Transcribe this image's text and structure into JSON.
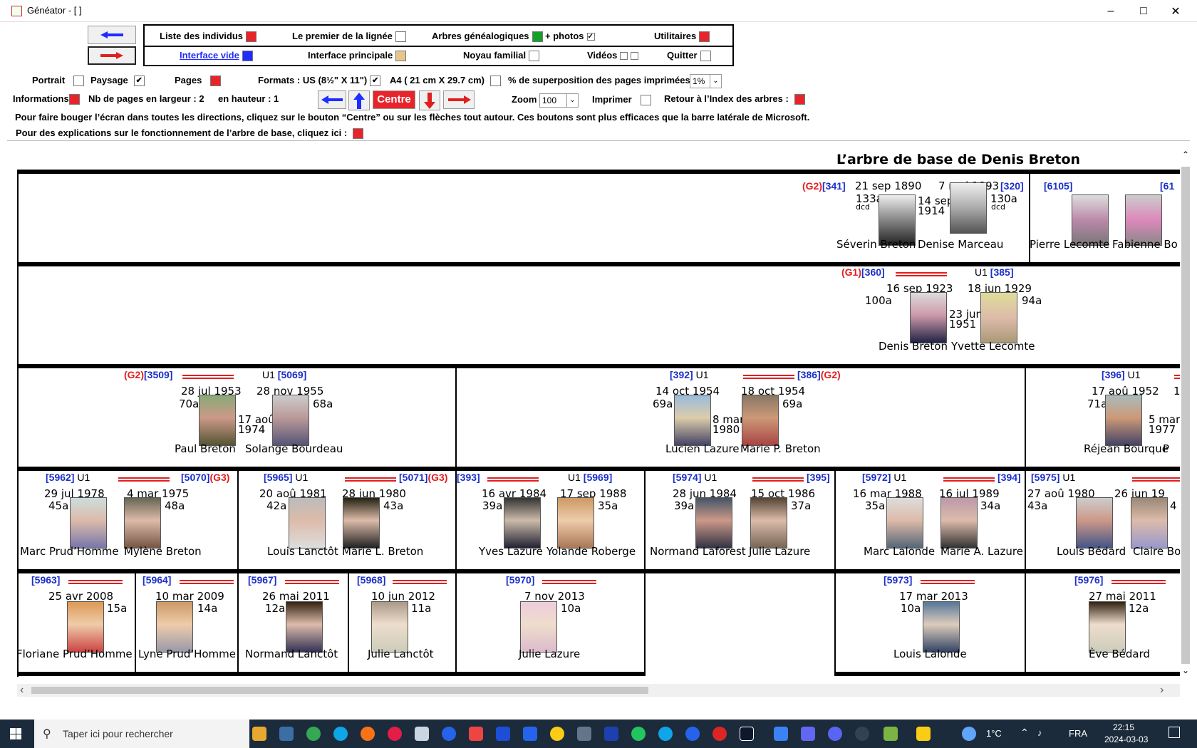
{
  "window": {
    "title": "Généator - [ ]"
  },
  "menu": {
    "row1": [
      "Liste des individus",
      "Le premier de la lignée",
      "Arbres généalogiques",
      "+ photos",
      "Utilitaires"
    ],
    "row2": [
      "Interface vide",
      "Interface principale",
      "Noyau familial",
      "Vidéos",
      "Quitter"
    ]
  },
  "controls": {
    "portrait": "Portrait",
    "paysage": "Paysage",
    "pages": "Pages",
    "formats": "Formats : US (8½\" X 11\")",
    "a4": "A4 ( 21 cm X 29.7 cm)",
    "superposition": "% de superposition des pages imprimées",
    "superposition_value": "1%",
    "informations": "Informations",
    "nb_largeur": "Nb de pages en largeur :  2",
    "hauteur": "en hauteur :  1",
    "centre": "Centre",
    "zoom": "Zoom",
    "zoom_value": "100",
    "imprimer": "Imprimer",
    "retour": "Retour à l’Index des arbres :",
    "info1": "Pour faire bouger l’écran dans toutes les directions, cliquez sur le bouton “Centre” ou sur les flèches tout autour. Ces boutons sont plus efficaces que la barre latérale de Microsoft.",
    "info2": "Pour des explications sur le fonctionnement de l’arbre de base, cliquez ici :"
  },
  "tree": {
    "title": "L’arbre de base de Denis Breton",
    "gen0": {
      "ids_left": "[341]",
      "gen_left": "(G2)",
      "date_left": "21 sep 1890",
      "age_left": "133a",
      "dcd_left": "dcd",
      "marriage": "14 sep\n1914",
      "date_right": "7 mai 1893",
      "id_right": "[320]",
      "age_right": "130a",
      "dcd_right": "dcd",
      "name_left": "Séverin Breton",
      "name_right": "Denise Marceau",
      "id_b1": "[6105]",
      "id_b2": "[61",
      "name_b1": "Pierre Lecomte",
      "name_b2": "Fabienne Bo"
    },
    "gen1": {
      "gen": "(G1)",
      "id_left": "[360]",
      "u": "U1",
      "id_right": "[385]",
      "date_left": "16 sep 1923",
      "age_left": "100a",
      "date_right": "18 jun 1929",
      "age_right": "94a",
      "marriage": "23 jun\n1951",
      "name_left": "Denis Breton",
      "name_right": "Yvette Lecomte"
    },
    "gen2": [
      {
        "gen": "(G2)",
        "id": "[3509]",
        "u": "U1",
        "id2": "[5069]",
        "d1": "28 jul 1953",
        "a1": "70a",
        "d2": "28 nov 1955",
        "a2": "68a",
        "m": "17 aoû\n1974",
        "n1": "Paul Breton",
        "n2": "Solange Bourdeau"
      },
      {
        "id": "[392]",
        "u": "U1",
        "id2": "[386]",
        "gen2": "(G2)",
        "d1": "14 oct 1954",
        "a1": "69a",
        "d2": "18 oct 1954",
        "a2": "69a",
        "m": "8 mar\n1980",
        "n1": "Lucien Lazure",
        "n2": "Marie P. Breton"
      },
      {
        "id": "[396]",
        "u": "U1",
        "d1": "17 aoû 1952",
        "a1": "71a",
        "d2": "1",
        "m": "5 mar\n1977",
        "n1": "Réjean Bourque",
        "n2": "P"
      }
    ],
    "gen3": [
      {
        "id": "[5962]",
        "u": "U1",
        "id2": "[5070]",
        "g": "(G3)",
        "d1": "29 jul 1978",
        "a1": "45a",
        "d2": "4 mar 1975",
        "a2": "48a",
        "n1": "Marc Prud’Homme",
        "n2": "Mylène Breton"
      },
      {
        "id": "[5965]",
        "u": "U1",
        "id2": "[5071]",
        "g": "(G3)",
        "d1": "20 aoû 1981",
        "a1": "42a",
        "d2": "28 jun 1980",
        "a2": "43a",
        "n1": "Louis Lanctôt",
        "n2": "Marie L. Breton"
      },
      {
        "id": "[393]",
        "u": "U1",
        "id2": "[5969]",
        "d1": "16 avr 1984",
        "a1": "39a",
        "d2": "17 sep 1988",
        "a2": "35a",
        "n1": "Yves Lazure",
        "n2": "Yolande Roberge"
      },
      {
        "id": "[5974]",
        "u": "U1",
        "id2": "[395]",
        "d1": "28 jun 1984",
        "a1": "39a",
        "d2": "15 oct 1986",
        "a2": "37a",
        "n1": "Normand Laforest",
        "n2": "Julie Lazure"
      },
      {
        "id": "[5972]",
        "u": "U1",
        "id2": "[394]",
        "d1": "16 mar 1988",
        "a1": "35a",
        "d2": "16 jul 1989",
        "a2": "34a",
        "n1": "Marc Lalonde",
        "n2": "Marie A. Lazure"
      },
      {
        "id": "[5975]",
        "u": "U1",
        "d1": "27 aoû 1980",
        "a1": "43a",
        "d2": "26 jun 19",
        "a2": "4",
        "n1": "Louis Bédard",
        "n2": "Claire Bou"
      }
    ],
    "gen4": [
      {
        "id": "[5963]",
        "d": "25 avr 2008",
        "a": "15a",
        "n": "Floriane Prud’Homme"
      },
      {
        "id": "[5964]",
        "d": "10 mar 2009",
        "a": "14a",
        "n": "Lyne Prud’Homme"
      },
      {
        "id": "[5967]",
        "d": "26 mai 2011",
        "a": "12a",
        "n": "Normand Lanctôt"
      },
      {
        "id": "[5968]",
        "d": "10 jun 2012",
        "a": "11a",
        "n": "Julie Lanctôt"
      },
      {
        "id": "[5970]",
        "d": "7 nov 2013",
        "a": "10a",
        "n": "Julie Lazure"
      },
      {
        "id": "[5973]",
        "d": "17 mar 2013",
        "a": "10a",
        "n": "Louis Lalonde"
      },
      {
        "id": "[5976]",
        "d": "27 mai 2011",
        "a": "12a",
        "n": "Ève Bédard"
      }
    ]
  },
  "taskbar": {
    "search": "Taper ici pour rechercher",
    "temp": "1°C",
    "lang": "FRA",
    "time": "22:15",
    "date": "2024-03-03"
  },
  "colors": {
    "red": "#e8242b",
    "blue_id": "#1b2fc9",
    "taskbar": "#1b2b3b"
  }
}
